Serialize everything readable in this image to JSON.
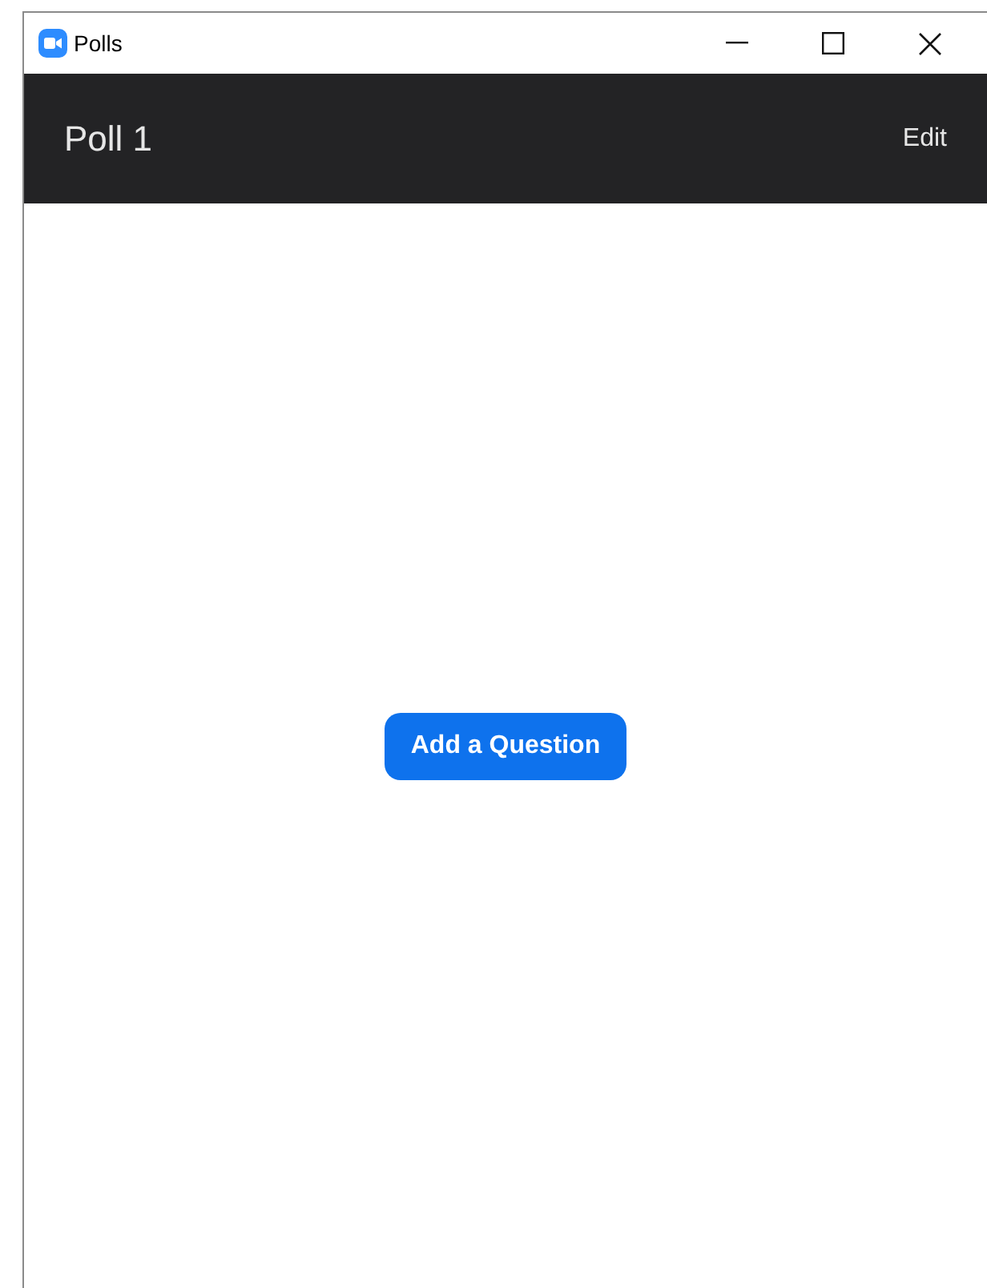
{
  "window": {
    "title": "Polls"
  },
  "header": {
    "title": "Poll 1",
    "action": "Edit"
  },
  "content": {
    "button": "Add a Question"
  }
}
